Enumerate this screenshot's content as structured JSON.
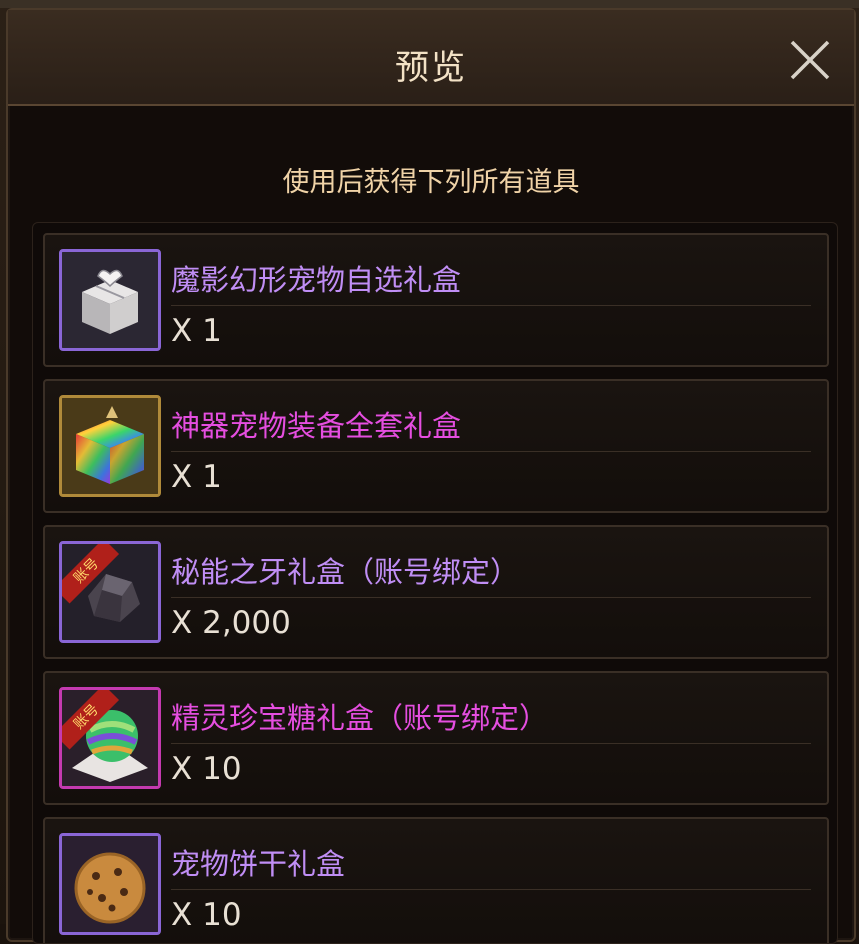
{
  "dialog": {
    "title": "预览",
    "subtitle": "使用后获得下列所有道具"
  },
  "colors": {
    "name_purple": "#c08ef5",
    "name_magenta": "#e54ee0",
    "icon_border": "#8a66d6"
  },
  "items": [
    {
      "name": "魔影幻形宠物自选礼盒",
      "quantity": "X 1",
      "color": "#c08ef5",
      "icon": "silver-gift-box-icon"
    },
    {
      "name": "神器宠物装备全套礼盒",
      "quantity": "X 1",
      "color": "#e54ee0",
      "icon": "rainbow-chest-icon"
    },
    {
      "name": "秘能之牙礼盒（账号绑定）",
      "quantity": "X 2,000",
      "color": "#c08ef5",
      "icon": "tooth-stone-icon",
      "badge": "账号"
    },
    {
      "name": "精灵珍宝糖礼盒（账号绑定）",
      "quantity": "X 10",
      "color": "#e54ee0",
      "icon": "candy-icon",
      "badge": "账号"
    },
    {
      "name": "宠物饼干礼盒",
      "quantity": "X 10",
      "color": "#c08ef5",
      "icon": "cookie-icon"
    }
  ]
}
